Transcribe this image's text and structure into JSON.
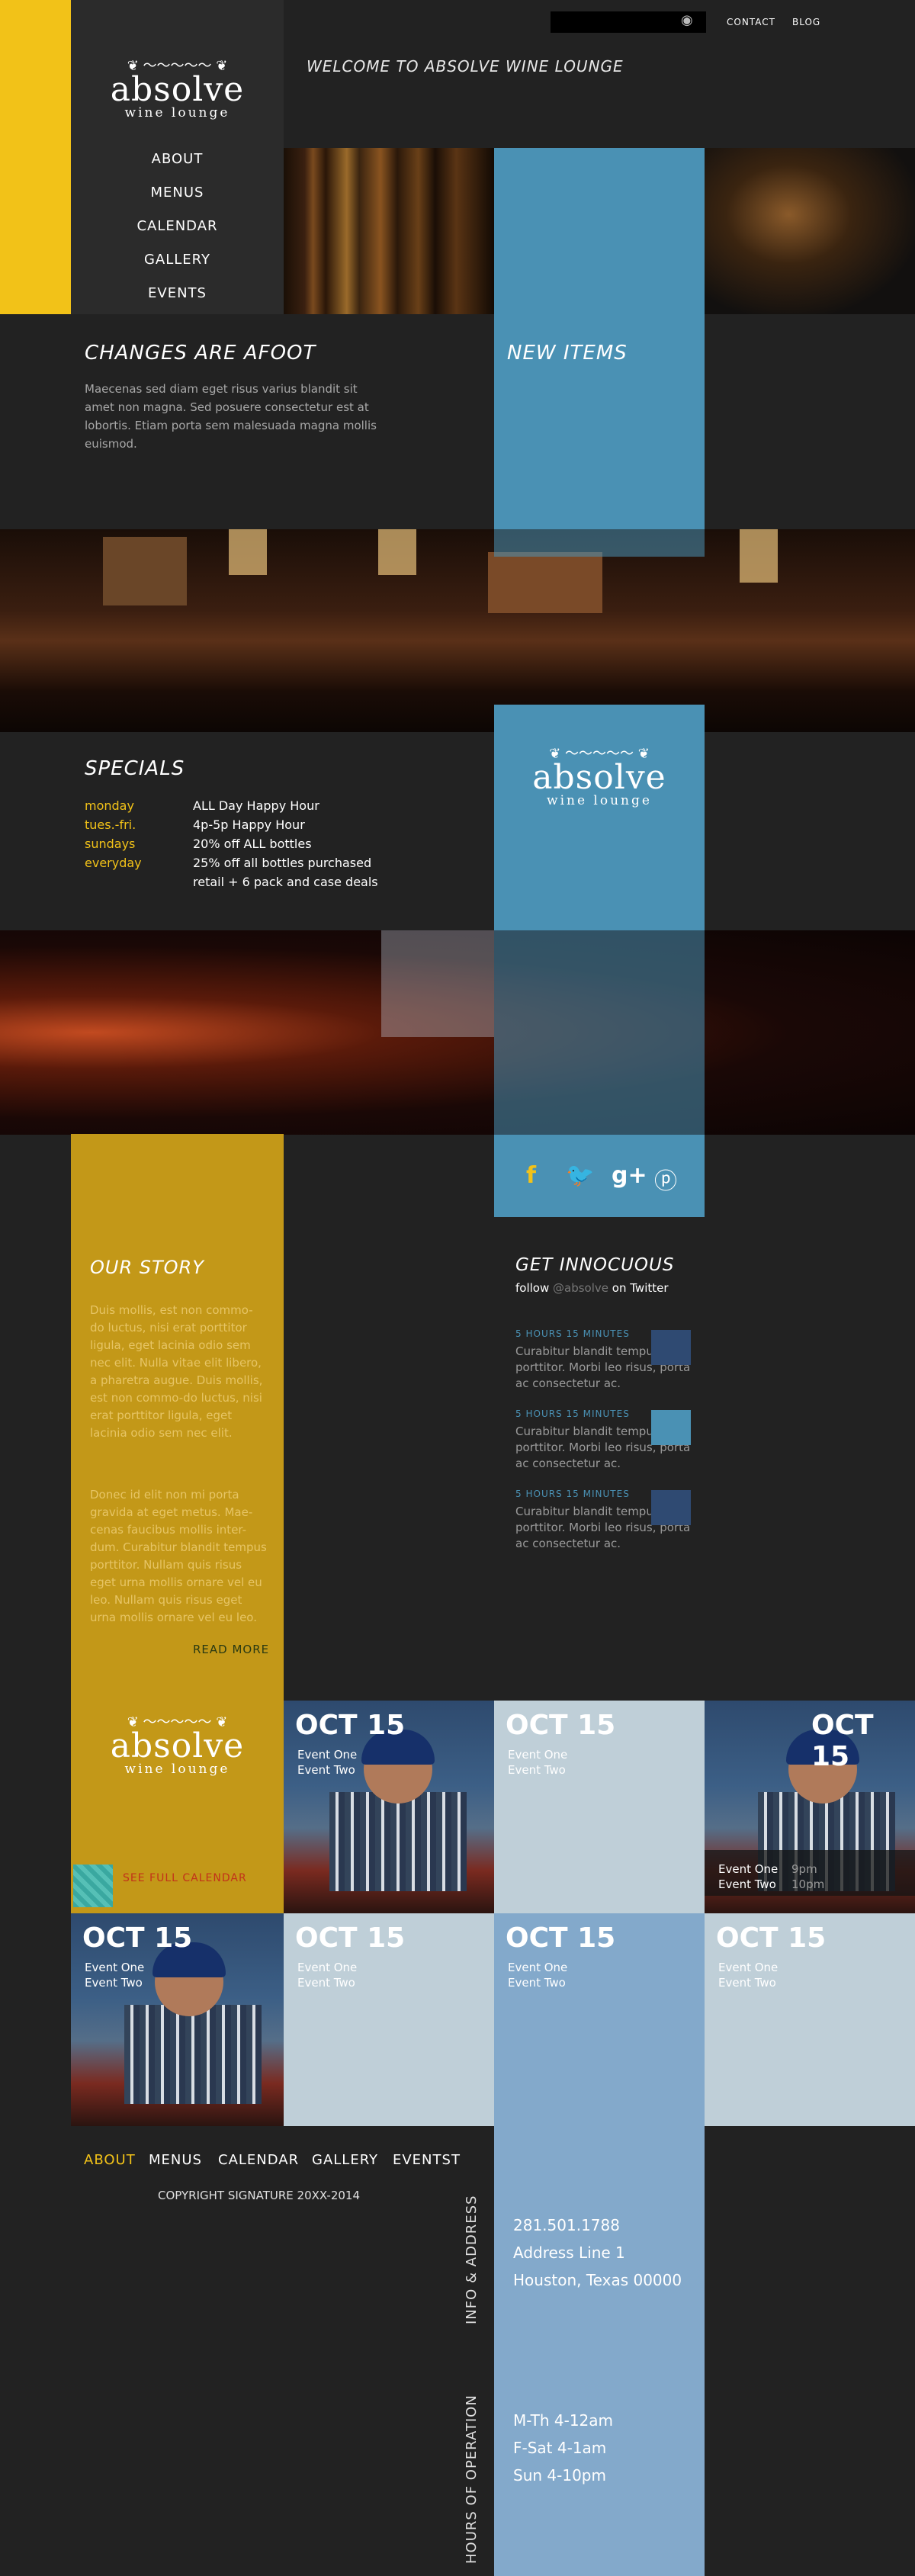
{
  "brand": {
    "logo_word": "absolve",
    "logo_sub": "wine lounge"
  },
  "header": {
    "welcome": "WELCOME TO ABSOLVE WINE LOUNGE",
    "top_links": [
      "CONTACT",
      "BLOG"
    ],
    "search": {
      "placeholder": "",
      "icon": "eye-icon"
    }
  },
  "nav": {
    "items": [
      "ABOUT",
      "MENUS",
      "CALENDAR",
      "GALLERY",
      "EVENTS"
    ]
  },
  "changes": {
    "title": "CHANGES ARE AFOOT",
    "body": "Maecenas sed diam eget risus varius blandit sit amet non magna. Sed posuere consectetur est at lobortis. Etiam porta sem malesuada magna mollis euismod."
  },
  "new_items": {
    "title": "NEW ITEMS"
  },
  "specials": {
    "title": "SPECIALS",
    "rows": [
      {
        "day": "monday",
        "deal": "ALL Day Happy Hour"
      },
      {
        "day": "tues.-fri.",
        "deal": "4p-5p Happy Hour"
      },
      {
        "day": "sundays",
        "deal": "20% off ALL bottles"
      },
      {
        "day": "everyday",
        "deal": "25% off all bottles purchased retail + 6 pack and case deals"
      }
    ]
  },
  "social": {
    "icons": [
      "facebook-icon",
      "twitter-icon",
      "google-plus-icon",
      "pinterest-icon"
    ],
    "glyphs": [
      "f",
      "🐦",
      "g+",
      "ⓟ"
    ]
  },
  "story": {
    "title": "OUR STORY",
    "p1": "Duis mollis, est non commo-do luctus, nisi erat porttitor ligula, eget lacinia odio sem nec elit. Nulla vitae elit libero, a pharetra augue. Duis mollis, est non commo-do luctus, nisi erat porttitor ligula, eget lacinia odio sem nec elit.",
    "p2": "Donec id elit non mi porta gravida at eget metus. Mae-cenas faucibus mollis inter-dum. Curabitur blandit tempus porttitor. Nullam quis risus eget urna mollis ornare vel eu leo. Nullam quis risus eget urna mollis ornare vel eu leo.",
    "read_more": "READ MORE"
  },
  "twitter": {
    "title": "GET INNOCUOUS",
    "follow_pre": "follow",
    "handle": "@absolve",
    "follow_post": "on Twitter",
    "tweets": [
      {
        "n1": "5",
        "u1": "HOURS",
        "n2": "15",
        "u2": "MINUTES",
        "text": "Curabitur blandit tempus porttitor. Morbi leo risus, porta ac consectetur ac."
      },
      {
        "n1": "5",
        "u1": "HOURS",
        "n2": "15",
        "u2": "MINUTES",
        "text": "Curabitur blandit tempus porttitor. Morbi leo risus, porta ac consectetur ac."
      },
      {
        "n1": "5",
        "u1": "HOURS",
        "n2": "15",
        "u2": "MINUTES",
        "text": "Curabitur blandit tempus porttitor. Morbi leo risus, porta ac consectetur ac."
      }
    ]
  },
  "calendar": {
    "see_full": "SEE FULL CALENDAR",
    "cells": [
      {
        "date": "OCT 15",
        "e1": "Event One",
        "e2": "Event Two"
      },
      {
        "date": "OCT 15",
        "e1": "Event One",
        "e2": "Event Two"
      },
      {
        "date": "OCT 15",
        "e1": "Event One",
        "e2": "Event Two",
        "t1": "9pm",
        "t2": "10pm"
      },
      {
        "date": "OCT 15",
        "e1": "Event One",
        "e2": "Event Two"
      },
      {
        "date": "OCT 15",
        "e1": "Event One",
        "e2": "Event Two"
      },
      {
        "date": "OCT 15",
        "e1": "Event One",
        "e2": "Event Two"
      },
      {
        "date": "OCT 15",
        "e1": "Event One",
        "e2": "Event Two"
      }
    ]
  },
  "footer": {
    "nav": [
      "ABOUT",
      "MENUS",
      "CALENDAR",
      "GALLERY",
      "EVENTST"
    ],
    "copyright": "COPYRIGHT SIGNATURE 20XX-2014",
    "info_label": "INFO & ADDRESS",
    "hours_label": "HOURS OF OPERATION",
    "info": [
      "281.501.1788",
      "Address Line 1",
      "Houston, Texas 00000"
    ],
    "hours": [
      "M-Th 4-12am",
      "F-Sat 4-1am",
      "Sun 4-10pm"
    ]
  },
  "colors": {
    "accent_yellow": "#f2c218",
    "story_gold": "#c39818",
    "blue": "#4a91b4",
    "dark": "#222222"
  }
}
